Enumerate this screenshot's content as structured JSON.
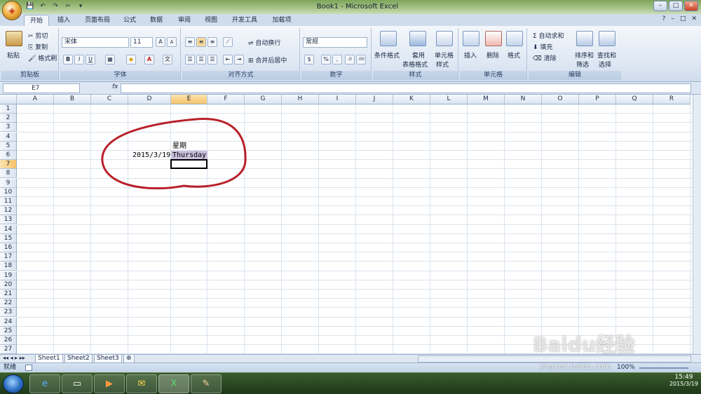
{
  "window": {
    "title": "Book1 - Microsoft Excel",
    "minimize": "–",
    "maximize": "□",
    "close": "✕"
  },
  "qat": [
    "💾",
    "↶",
    "↷",
    "✂",
    "▾"
  ],
  "tabs": [
    "开始",
    "插入",
    "页面布局",
    "公式",
    "数据",
    "审阅",
    "视图",
    "开发工具",
    "加载项"
  ],
  "help": "?",
  "ribbon": {
    "clipboard": {
      "label": "剪贴板",
      "paste": "粘贴",
      "cut": "剪切",
      "copy": "复制",
      "format_painter": "格式刷"
    },
    "font": {
      "label": "字体",
      "font_name": "宋体",
      "font_size": "11",
      "bold": "B",
      "italic": "I",
      "underline": "U",
      "grow": "A",
      "shrink": "A"
    },
    "alignment": {
      "label": "对齐方式",
      "wrap": "自动换行",
      "merge": "合并后居中"
    },
    "number": {
      "label": "数字",
      "format": "常规",
      "percent": "%",
      "comma": ","
    },
    "styles": {
      "label": "样式",
      "conditional": "条件格式",
      "table_format_1": "套用",
      "table_format_2": "表格格式",
      "cell_style_1": "单元格",
      "cell_style_2": "样式"
    },
    "cells": {
      "label": "单元格",
      "insert": "插入",
      "delete": "删除",
      "format": "格式"
    },
    "editing": {
      "label": "编辑",
      "autosum": "Σ 自动求和",
      "fill": "填充",
      "clear": "清除",
      "sort_1": "排序和",
      "sort_2": "筛选",
      "find_1": "查找和",
      "find_2": "选择"
    }
  },
  "formula_bar": {
    "name_box": "E7",
    "fx": "fx",
    "content": ""
  },
  "columns": [
    "A",
    "B",
    "C",
    "D",
    "E",
    "F",
    "G",
    "H",
    "I",
    "J",
    "K",
    "L",
    "M",
    "N",
    "O",
    "P",
    "Q",
    "R"
  ],
  "selected_column": "E",
  "rows": [
    "1",
    "2",
    "3",
    "4",
    "5",
    "6",
    "7",
    "8",
    "9",
    "10",
    "11",
    "12",
    "13",
    "14",
    "15",
    "16",
    "17",
    "18",
    "19",
    "20",
    "21",
    "22",
    "23",
    "24",
    "25",
    "26",
    "27"
  ],
  "selected_row": "7",
  "cells": {
    "E5": "星期",
    "D6": "2015/3/19",
    "E6": "Thursday"
  },
  "sheets": [
    "Sheet1",
    "Sheet2",
    "Sheet3"
  ],
  "active_sheet": "Sheet1",
  "status": {
    "ready": "就绪",
    "zoom": "100%"
  },
  "taskbar": {
    "time": "15:49",
    "date": "2015/3/19"
  },
  "watermark": {
    "text": "Baidu经验",
    "url": "jingyan.baidu.com"
  },
  "colors": {
    "annotation": "#b8202a",
    "selection_fill": "#c9bfdc",
    "accent": "#f5c36a"
  }
}
